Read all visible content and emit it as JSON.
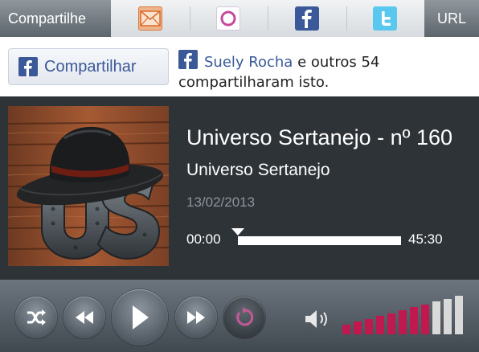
{
  "share": {
    "label": "Compartilhe",
    "url_label": "URL",
    "icons": [
      "email-icon",
      "orkut-icon",
      "facebook-icon",
      "twitter-icon"
    ]
  },
  "facebook": {
    "button_label": "Compartilhar",
    "friend_name": "Suely Rocha",
    "share_text": " e outros 54 compartilharam isto."
  },
  "track": {
    "title": "Universo Sertanejo - nº 160",
    "artist": "Universo Sertanejo",
    "date": "13/02/2013",
    "current_time": "00:00",
    "total_time": "45:30",
    "progress": 0
  },
  "volume": {
    "level": 8,
    "max": 11,
    "active_color": "#c0194f",
    "inactive_color": "#d9d9d9"
  },
  "colors": {
    "facebook": "#3b5998",
    "accent": "#c0194f",
    "twitter": "#5ac8ee"
  }
}
